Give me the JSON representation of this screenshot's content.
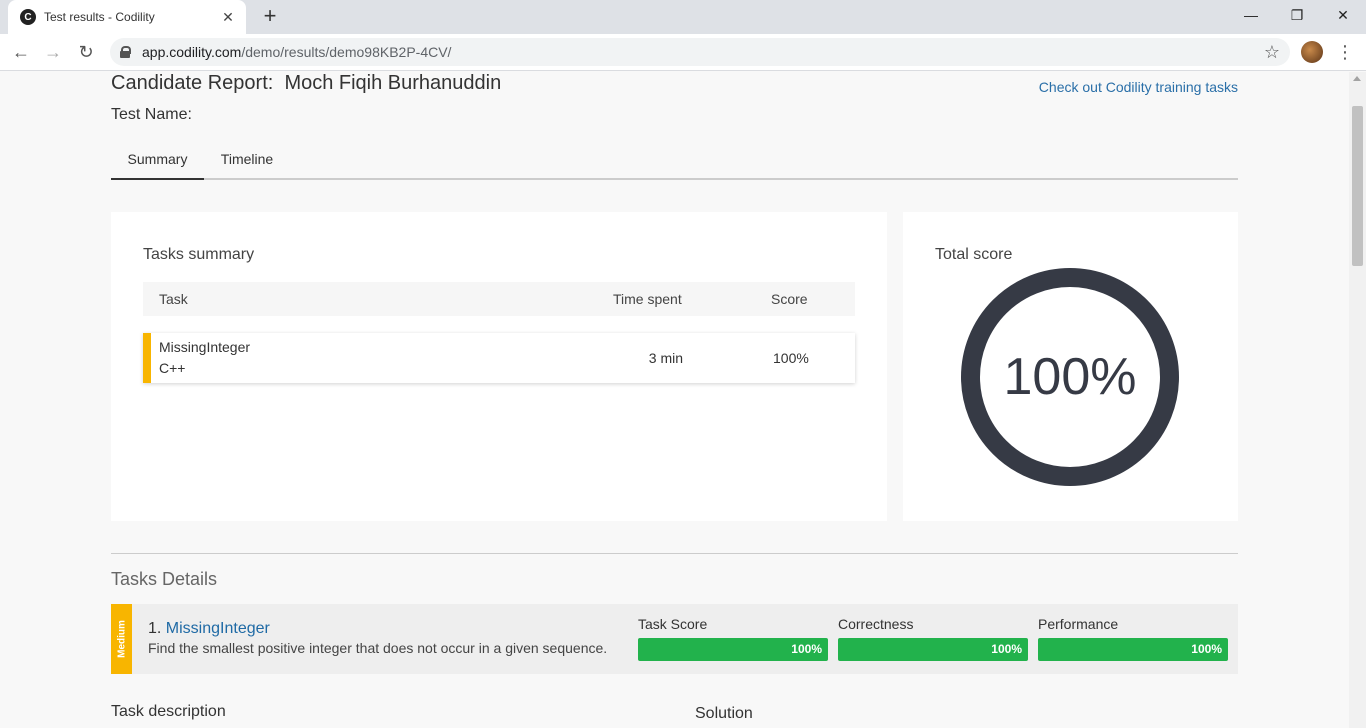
{
  "browser": {
    "tab_title": "Test results - Codility",
    "favicon_letter": "C",
    "url_host": "app.codility.com",
    "url_path": "/demo/results/demo98KB2P-4CV/"
  },
  "header": {
    "title": "Candidate Report:  Moch Fiqih Burhanuddin",
    "training_link": "Check out Codility training tasks",
    "test_name_label": "Test Name:"
  },
  "tabs": [
    "Summary",
    "Timeline"
  ],
  "tasks_summary": {
    "title": "Tasks summary",
    "columns": [
      "Task",
      "Time spent",
      "Score"
    ],
    "rows": [
      {
        "task": "MissingInteger",
        "lang": "C++",
        "time": "3 min",
        "score": "100%"
      }
    ]
  },
  "total_score": {
    "title": "Total score",
    "value": "100%"
  },
  "tasks_details": {
    "title": "Tasks Details",
    "items": [
      {
        "difficulty": "Medium",
        "number": "1.",
        "name": "MissingInteger",
        "description": "Find the smallest positive integer that does not occur in a given sequence.",
        "metrics": [
          {
            "label": "Task Score",
            "value": "100%"
          },
          {
            "label": "Correctness",
            "value": "100%"
          },
          {
            "label": "Performance",
            "value": "100%"
          }
        ]
      }
    ]
  },
  "sections": {
    "task_description": "Task description",
    "solution": "Solution"
  },
  "colors": {
    "accent_yellow": "#f8b500",
    "score_green": "#22b24c",
    "link_blue": "#2a6fa8",
    "donut": "#363a45"
  }
}
